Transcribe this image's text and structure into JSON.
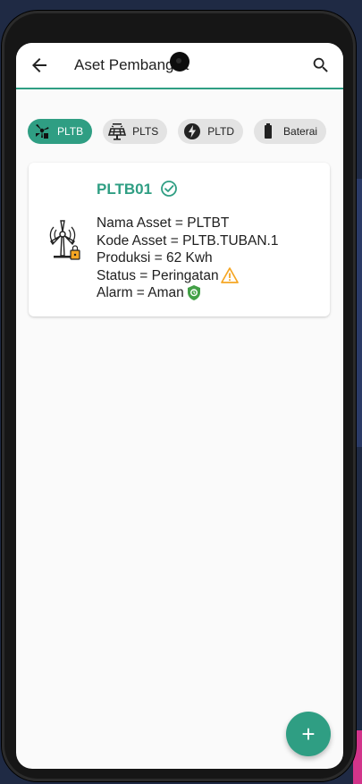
{
  "appbar": {
    "title": "Aset Pembangkit"
  },
  "chips": [
    {
      "label": "PLTB",
      "icon": "wind-turbine-icon",
      "active": true
    },
    {
      "label": "PLTS",
      "icon": "solar-panel-icon",
      "active": false
    },
    {
      "label": "PLTD",
      "icon": "bolt-icon",
      "active": false
    },
    {
      "label": "Baterai",
      "icon": "battery-icon",
      "active": false
    }
  ],
  "card": {
    "title": "PLTB01",
    "verified_icon": "check-circle-icon",
    "icon": "wind-turbine-lock-icon",
    "lines": {
      "nama": "Nama Asset = PLTBT",
      "kode": "Kode Asset = PLTB.TUBAN.1",
      "produksi": "Produksi = 62 Kwh",
      "status": "Status = Peringatan",
      "alarm": "Alarm = Aman"
    },
    "status_icon": "warning-icon",
    "alarm_icon": "shield-icon"
  },
  "fab": {
    "label": "+",
    "icon": "add-icon"
  },
  "colors": {
    "accent": "#2f9e83",
    "warning": "#f5a623",
    "shield": "#43a047"
  }
}
